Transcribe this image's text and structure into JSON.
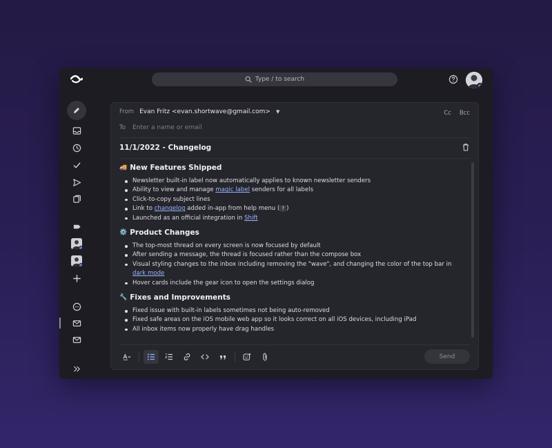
{
  "topbar": {
    "search_placeholder": "Type / to search",
    "help_icon": "help-circle-icon",
    "avatar": "user-avatar"
  },
  "sidebar": {
    "items": [
      {
        "name": "compose",
        "icon": "pencil-icon"
      },
      {
        "name": "inbox",
        "icon": "inbox-icon"
      },
      {
        "name": "snoozed",
        "icon": "clock-icon"
      },
      {
        "name": "done",
        "icon": "check-icon"
      },
      {
        "name": "sent",
        "icon": "send-icon"
      },
      {
        "name": "drafts",
        "icon": "drafts-icon"
      },
      {
        "name": "labels",
        "icon": "label-icon"
      },
      {
        "name": "contact-1",
        "icon": "avatar"
      },
      {
        "name": "contact-2",
        "icon": "avatar"
      },
      {
        "name": "add",
        "icon": "plus-icon"
      },
      {
        "name": "chat",
        "icon": "chat-icon"
      },
      {
        "name": "mail-1",
        "icon": "mail-icon"
      },
      {
        "name": "mail-2",
        "icon": "mail-icon"
      },
      {
        "name": "expand",
        "icon": "double-chevron-right-icon"
      }
    ]
  },
  "compose": {
    "from_label": "From",
    "from_value": "Evan Fritz <evan.shortwave@gmail.com>",
    "cc_label": "Cc",
    "bcc_label": "Bcc",
    "to_label": "To",
    "to_placeholder": "Enter a name or email",
    "subject": "11/1/2022 - Changelog",
    "sections": [
      {
        "emoji": "🚚",
        "title": "New Features Shipped",
        "items": [
          {
            "pre": "Newsletter built-in label now automatically applies to known newsletter senders"
          },
          {
            "pre": "Ability to view and manage ",
            "link": "magic label",
            "post": " senders for all labels"
          },
          {
            "pre": "Click-to-copy subject lines"
          },
          {
            "pre": "Link to ",
            "link": "changelog",
            "post": " added in-app from help menu (",
            "kbd": "?",
            "post2": ")"
          },
          {
            "pre": "Launched as an official integration in ",
            "link": "Shift"
          }
        ]
      },
      {
        "emoji": "⚙️",
        "title": "Product Changes",
        "items": [
          {
            "pre": "The top-most thread on every screen is now focused by default"
          },
          {
            "pre": "After sending a message, the thread is focused rather than the compose box"
          },
          {
            "pre": "Visual styling changes to the inbox including removing the \"wave\", and changing the color of the top bar in ",
            "link": "dark mode"
          },
          {
            "pre": "Hover cards include the gear icon to open the settings dialog"
          }
        ]
      },
      {
        "emoji": "🔧",
        "title": "Fixes and Improvements",
        "items": [
          {
            "pre": "Fixed issue with built-in labels sometimes not being auto-removed"
          },
          {
            "pre": "Fixed safe areas on the iOS mobile web app so it looks correct on all iOS devices, including iPad"
          },
          {
            "pre": "All inbox items now properly have drag handles"
          }
        ]
      }
    ],
    "send_label": "Send"
  },
  "colors": {
    "background": "#2a1f55",
    "app": "#1c1c22",
    "compose": "#25252c",
    "link": "#9bb4ff"
  }
}
